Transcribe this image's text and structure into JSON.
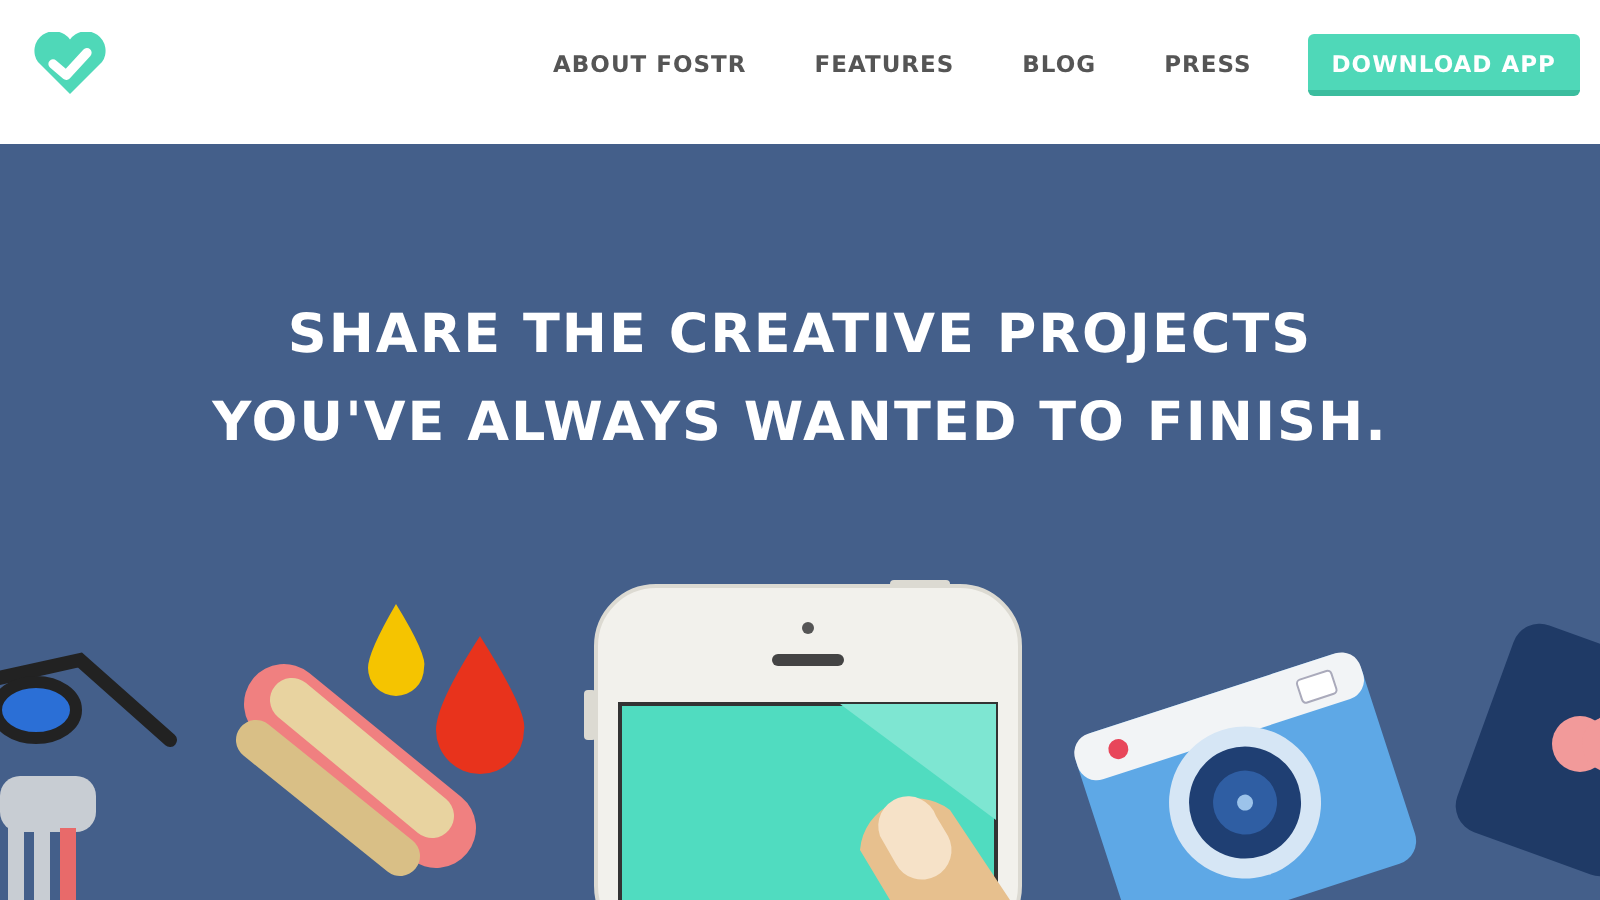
{
  "header": {
    "nav": [
      {
        "label": "ABOUT FOSTR"
      },
      {
        "label": "FEATURES"
      },
      {
        "label": "BLOG"
      },
      {
        "label": "PRESS"
      }
    ],
    "cta": "DOWNLOAD APP"
  },
  "hero": {
    "headline": [
      "SHARE THE CREATIVE PROJECTS",
      "YOU'VE ALWAYS WANTED TO FINISH."
    ]
  }
}
